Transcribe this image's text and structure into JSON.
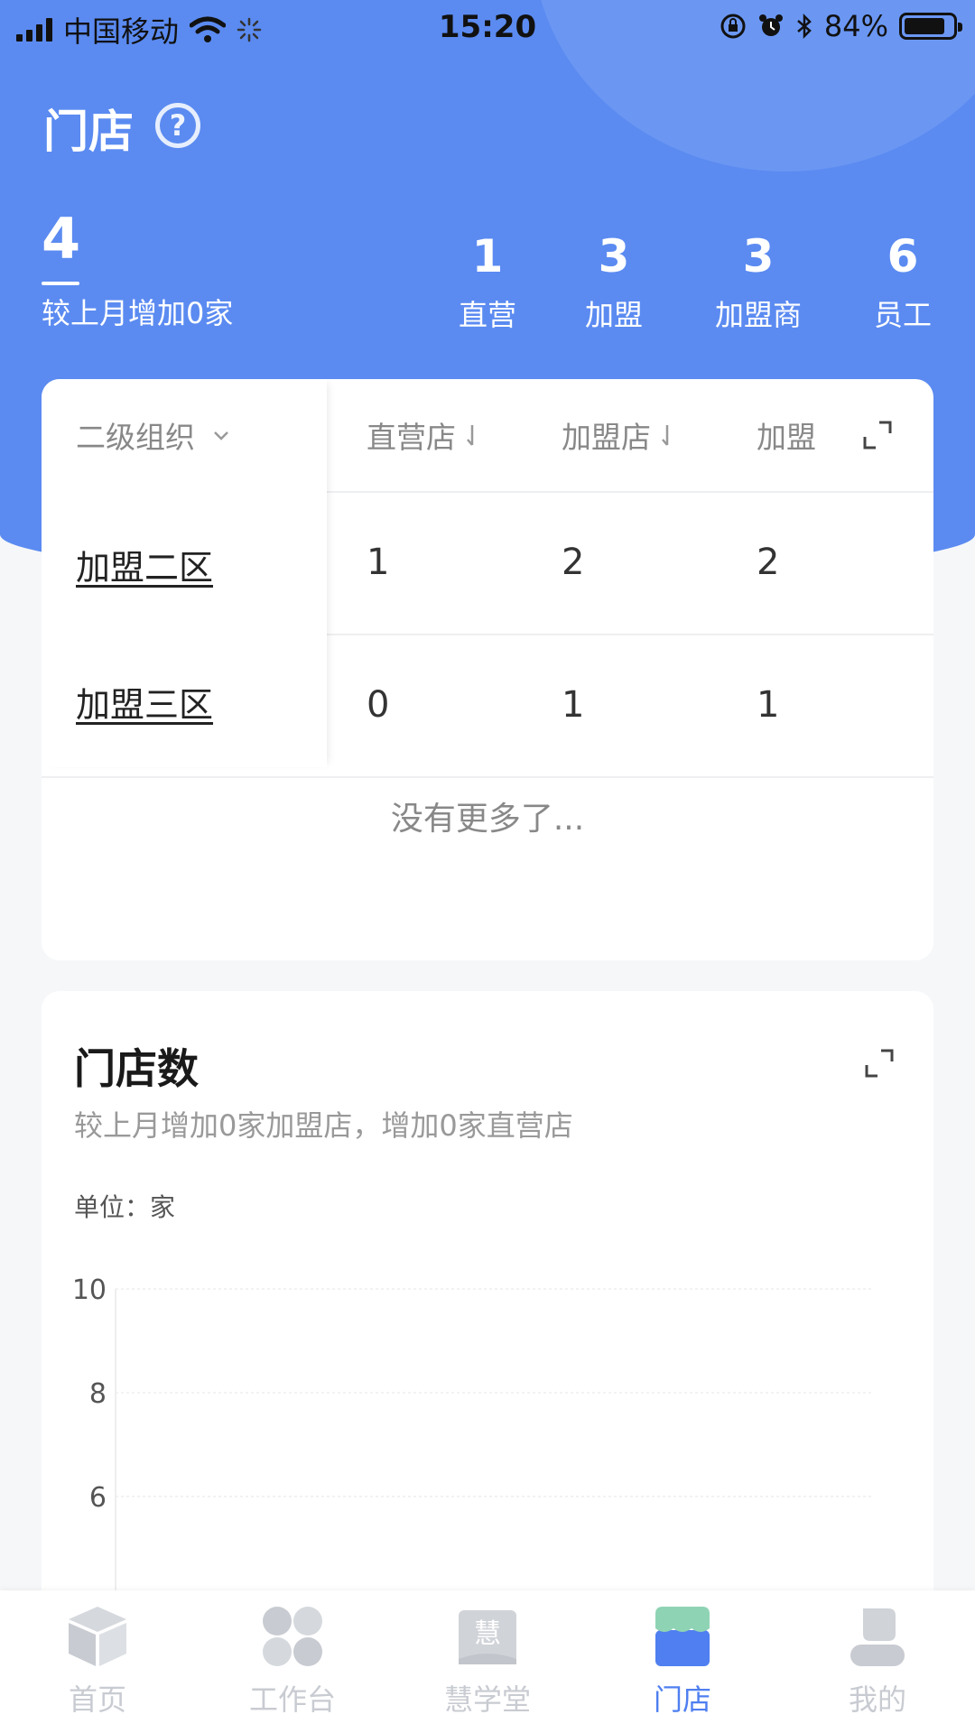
{
  "status_bar": {
    "carrier": "中国移动",
    "time": "15:20",
    "battery": "84%",
    "battery_level": 0.84,
    "icons": [
      "signal-icon",
      "wifi-icon",
      "loading-icon",
      "orientation-lock-icon",
      "alarm-icon",
      "bluetooth-icon",
      "battery-icon"
    ]
  },
  "header": {
    "title": "门店",
    "help_glyph": "?",
    "total": "4",
    "total_sub": "较上月增加0家",
    "stats": [
      {
        "value": "1",
        "label": "直营"
      },
      {
        "value": "3",
        "label": "加盟"
      },
      {
        "value": "3",
        "label": "加盟商"
      },
      {
        "value": "6",
        "label": "员工"
      }
    ]
  },
  "table": {
    "group_label": "二级组织",
    "columns": [
      "直营店",
      "加盟店",
      "加盟"
    ],
    "rows": [
      {
        "name": "加盟二区",
        "values": [
          "1",
          "2",
          "2"
        ]
      },
      {
        "name": "加盟三区",
        "values": [
          "0",
          "1",
          "1"
        ]
      }
    ],
    "footer": "没有更多了..."
  },
  "chart_card": {
    "title": "门店数",
    "subtitle": "较上月增加0家加盟店，增加0家直营店",
    "unit": "单位：家"
  },
  "chart_data": {
    "type": "line",
    "title": "门店数",
    "ylabel": "单位：家",
    "y_ticks_visible": [
      10,
      8,
      6
    ],
    "ylim": [
      0,
      10
    ],
    "grid": true,
    "series": []
  },
  "tabbar": {
    "items": [
      {
        "label": "首页",
        "icon": "home-cube-icon",
        "active": false
      },
      {
        "label": "工作台",
        "icon": "workbench-icon",
        "active": false
      },
      {
        "label": "慧学堂",
        "icon": "book-icon",
        "active": false,
        "glyph": "慧"
      },
      {
        "label": "门店",
        "icon": "store-icon",
        "active": true
      },
      {
        "label": "我的",
        "icon": "profile-icon",
        "active": false
      }
    ]
  },
  "colors": {
    "primary": "#5b8bf1",
    "active_tab": "#4f7ff0",
    "inactive_tab": "#c8cbd1",
    "store_awning": "#8fd3b5"
  }
}
